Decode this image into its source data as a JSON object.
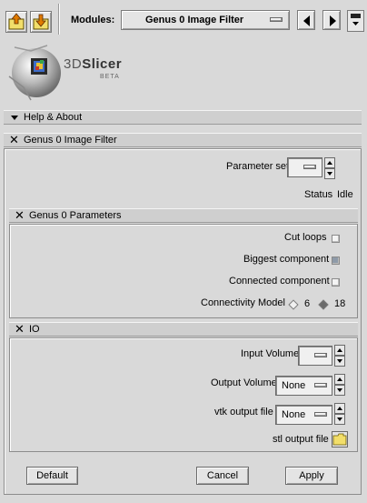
{
  "toolbar": {
    "modules_label": "Modules:",
    "module_selected": "Genus 0 Image Filter"
  },
  "logo": {
    "name_prefix": "3D",
    "name": "Slicer",
    "tag": "BETA"
  },
  "sections": {
    "help_about": "Help & About",
    "module_title": "Genus 0 Image Filter",
    "params": "Genus 0 Parameters",
    "io": "IO"
  },
  "parameter_set": {
    "label": "Parameter set"
  },
  "status": {
    "label": "Status",
    "value": "Idle"
  },
  "parameters": {
    "cut_loops": {
      "label": "Cut loops",
      "checked": false
    },
    "biggest_component": {
      "label": "Biggest component",
      "checked": true
    },
    "connected_component": {
      "label": "Connected component",
      "checked": false
    },
    "connectivity_model": {
      "label": "Connectivity Model",
      "option_6": "6",
      "option_18": "18",
      "selected": "18"
    }
  },
  "io": {
    "input_volume": {
      "label": "Input Volume",
      "value": ""
    },
    "output_volume": {
      "label": "Output Volume",
      "value": "None"
    },
    "vtk_output": {
      "label": "vtk output file",
      "value": "None"
    },
    "stl_output": {
      "label": "stl output file"
    }
  },
  "buttons": {
    "default": "Default",
    "cancel": "Cancel",
    "apply": "Apply"
  },
  "colors": {
    "background": "#d9d9d9",
    "header": "#cfcfcf",
    "checked": "#8e9aa8",
    "folder": "#f2de6a"
  }
}
